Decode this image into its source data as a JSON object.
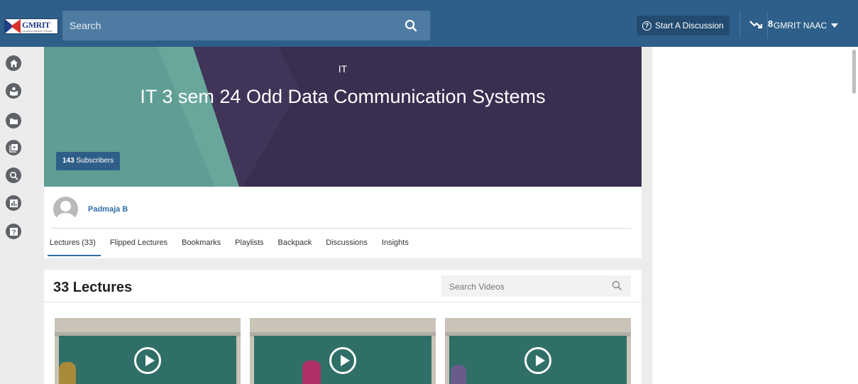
{
  "header": {
    "logo_text": "GMRIT",
    "logo_subtext": "Learning Means Growth",
    "search_placeholder": "Search",
    "discuss_label": "Start A Discussion",
    "trend_count": "8",
    "user_name": "GMRIT NAAC"
  },
  "rail": {
    "items": [
      "home-icon",
      "reader-icon",
      "folder-icon",
      "playlist-icon",
      "search-icon",
      "analytics-icon",
      "help-icon"
    ]
  },
  "banner": {
    "category": "IT",
    "title": "IT 3 sem 24 Odd Data Communication Systems",
    "subscriber_count": "143",
    "subscriber_label": "Subscribers"
  },
  "profile": {
    "name": "Padmaja B",
    "tabs": [
      "Lectures (33)",
      "Flipped Lectures",
      "Bookmarks",
      "Playlists",
      "Backpack",
      "Discussions",
      "Insights"
    ],
    "active_tab": 0
  },
  "lectures": {
    "title": "33 Lectures",
    "search_placeholder": "Search Videos",
    "video_count_visible": 3
  },
  "colors": {
    "topbar": "#2e5f8a",
    "accent": "#2e6fa7",
    "banner_purple": "#3a2f50",
    "banner_teal": "#5f9d95"
  }
}
